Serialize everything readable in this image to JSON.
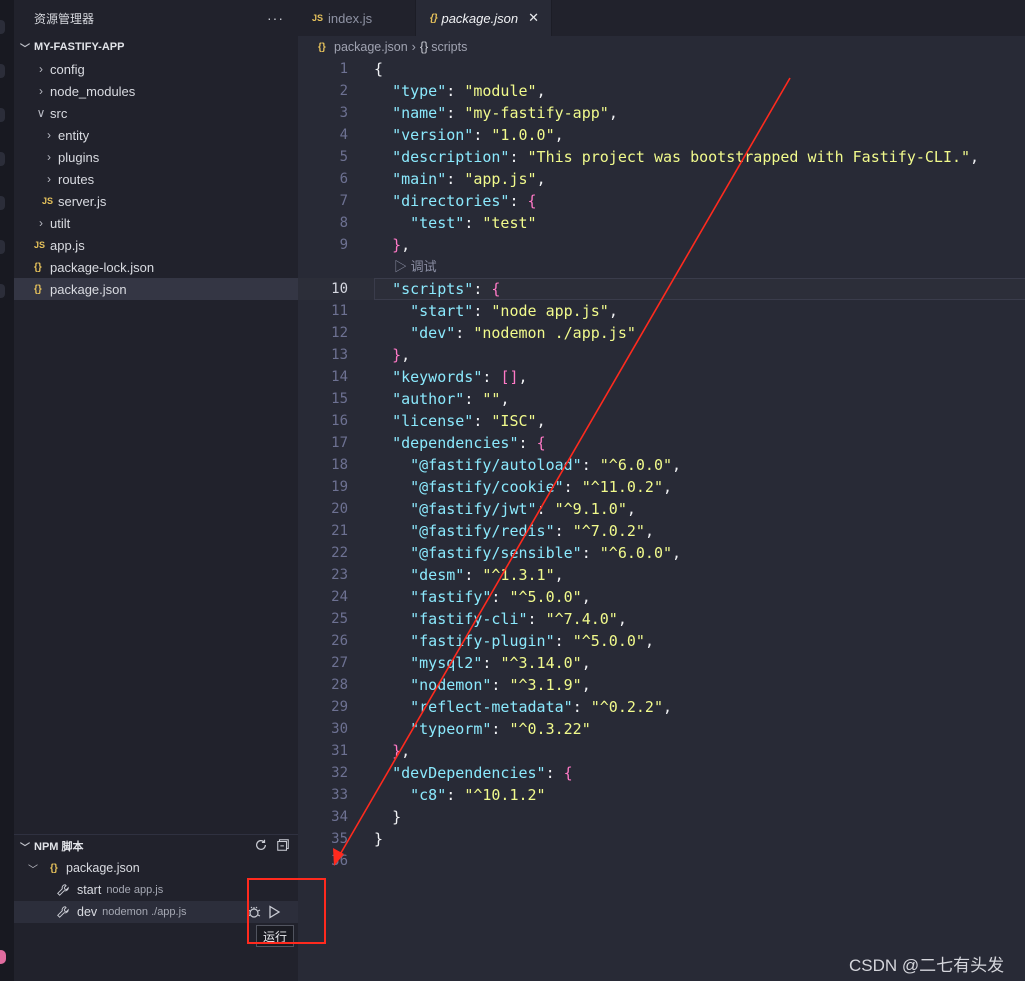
{
  "explorer": {
    "title": "资源管理器",
    "more_label": "···",
    "project": "MY-FASTIFY-APP",
    "items": [
      {
        "label": "config",
        "type": "folder",
        "depth": 0,
        "open": false
      },
      {
        "label": "node_modules",
        "type": "folder",
        "depth": 0,
        "open": false
      },
      {
        "label": "src",
        "type": "folder",
        "depth": 0,
        "open": true
      },
      {
        "label": "entity",
        "type": "folder",
        "depth": 1,
        "open": false
      },
      {
        "label": "plugins",
        "type": "folder",
        "depth": 1,
        "open": false
      },
      {
        "label": "routes",
        "type": "folder",
        "depth": 1,
        "open": false
      },
      {
        "label": "server.js",
        "type": "js",
        "depth": 1
      },
      {
        "label": "utilt",
        "type": "folder",
        "depth": 0,
        "open": false
      },
      {
        "label": "app.js",
        "type": "js",
        "depth": 0
      },
      {
        "label": "package-lock.json",
        "type": "json",
        "depth": 0
      },
      {
        "label": "package.json",
        "type": "json",
        "depth": 0,
        "selected": true
      }
    ]
  },
  "npm": {
    "title": "NPM 脚本",
    "file": "package.json",
    "scripts": [
      {
        "name": "start",
        "command": "node app.js"
      },
      {
        "name": "dev",
        "command": "nodemon ./app.js"
      }
    ],
    "tooltip": "运行"
  },
  "tabs": [
    {
      "label": "index.js",
      "icon": "JS",
      "active": false
    },
    {
      "label": "package.json",
      "icon": "{}",
      "active": true
    }
  ],
  "breadcrumb": {
    "file": "package.json",
    "symbol": "scripts"
  },
  "codelens": "▷ 调试",
  "current_line": 10,
  "code_lines": [
    "{",
    "  \"type\": \"module\",",
    "  \"name\": \"my-fastify-app\",",
    "  \"version\": \"1.0.0\",",
    "  \"description\": \"This project was bootstrapped with Fastify-CLI.\",",
    "  \"main\": \"app.js\",",
    "  \"directories\": {",
    "    \"test\": \"test\"",
    "  },",
    "  \"scripts\": {",
    "    \"start\": \"node app.js\",",
    "    \"dev\": \"nodemon ./app.js\"",
    "  },",
    "  \"keywords\": [],",
    "  \"author\": \"\",",
    "  \"license\": \"ISC\",",
    "  \"dependencies\": {",
    "    \"@fastify/autoload\": \"^6.0.0\",",
    "    \"@fastify/cookie\": \"^11.0.2\",",
    "    \"@fastify/jwt\": \"^9.1.0\",",
    "    \"@fastify/redis\": \"^7.0.2\",",
    "    \"@fastify/sensible\": \"^6.0.0\",",
    "    \"desm\": \"^1.3.1\",",
    "    \"fastify\": \"^5.0.0\",",
    "    \"fastify-cli\": \"^7.4.0\",",
    "    \"fastify-plugin\": \"^5.0.0\",",
    "    \"mysql2\": \"^3.14.0\",",
    "    \"nodemon\": \"^3.1.9\",",
    "    \"reflect-metadata\": \"^0.2.2\",",
    "    \"typeorm\": \"^0.3.22\"",
    "  },",
    "  \"devDependencies\": {",
    "    \"c8\": \"^10.1.2\"",
    "  }",
    "}",
    ""
  ],
  "watermark": "CSDN @二七有头发",
  "colors": {
    "annotation": "#ff2a1e",
    "key": "#8be9fd",
    "string": "#f1fa8c",
    "bracket": "#ff79c6"
  }
}
